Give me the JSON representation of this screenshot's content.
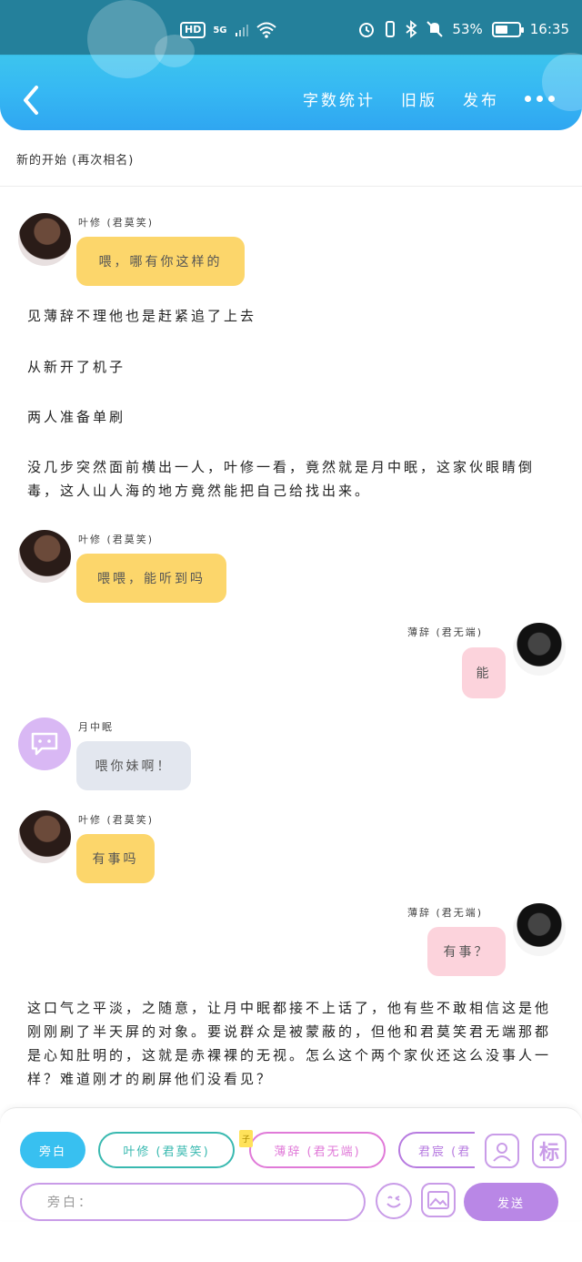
{
  "status_bar": {
    "hd": "HD",
    "network": "5G",
    "battery_percent": "53%",
    "time": "16:35",
    "battery_level": 0.53
  },
  "header": {
    "actions": [
      "字数统计",
      "旧版",
      "发布"
    ]
  },
  "chapter": {
    "title": "新的开始 (再次相名)"
  },
  "messages": [
    {
      "type": "chat",
      "side": "left",
      "speaker": "叶修 (君莫笑)",
      "text": "喂，哪有你这样的",
      "color": "#fcd66b"
    },
    {
      "type": "narration",
      "text": "见薄辞不理他也是赶紧追了上去"
    },
    {
      "type": "narration",
      "text": "从新开了机子"
    },
    {
      "type": "narration",
      "text": "两人准备单刷"
    },
    {
      "type": "narration",
      "text": "没几步突然面前横出一人，叶修一看，竟然就是月中眠，这家伙眼睛倒毒，这人山人海的地方竟然能把自己给找出来。"
    },
    {
      "type": "chat",
      "side": "left",
      "speaker": "叶修 (君莫笑)",
      "text": "喂喂，能听到吗",
      "color": "#fcd66b"
    },
    {
      "type": "chat",
      "side": "right",
      "speaker": "薄辞 (君无端)",
      "text": "能",
      "color": "#fcd3dc"
    },
    {
      "type": "chat",
      "side": "left",
      "speaker": "月中眠",
      "text": "喂你妹啊！",
      "color": "#e3e7ef"
    },
    {
      "type": "chat",
      "side": "left",
      "speaker": "叶修 (君莫笑)",
      "text": "有事吗",
      "color": "#fcd66b"
    },
    {
      "type": "chat",
      "side": "right",
      "speaker": "薄辞 (君无端)",
      "text": "有事？",
      "color": "#fcd3dc"
    },
    {
      "type": "narration",
      "text": "这口气之平淡，之随意，让月中眠都接不上话了，他有些不敢相信这是他刚刚刷了半天屏的对象。要说群众是被蒙蔽的，但他和君莫笑君无端那都是心知肚明的，这就是赤裸裸的无视。怎么这个两个家伙还这么没事人一样？难道刚才的刷屏他们没看见？"
    }
  ],
  "composer": {
    "roles": [
      "旁白",
      "叶修 (君莫笑)",
      "薄辞 (君无端)",
      "君宸 (君"
    ],
    "mark_label": "标",
    "input_placeholder": "旁白：",
    "send_label": "发送",
    "tag_mini": "子"
  }
}
